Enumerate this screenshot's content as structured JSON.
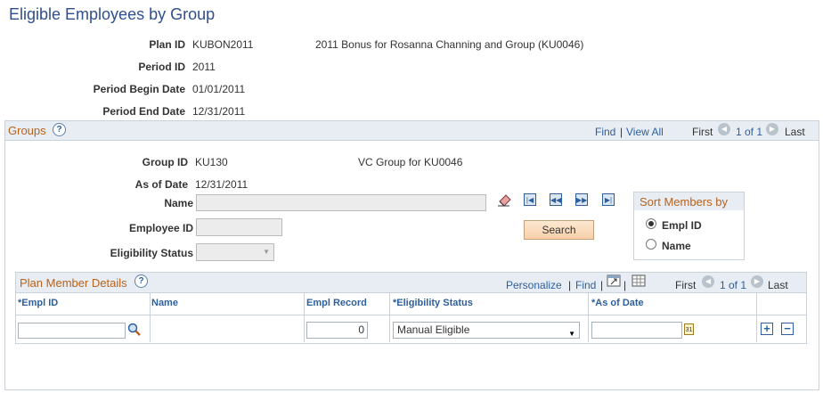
{
  "page": {
    "title": "Eligible Employees by Group"
  },
  "plan": {
    "plan_id_label": "Plan ID",
    "plan_id": "KUBON2011",
    "plan_desc": "2011 Bonus for Rosanna Channing and Group (KU0046)",
    "period_id_label": "Period ID",
    "period_id": "2011",
    "begin_label": "Period Begin Date",
    "begin": "01/01/2011",
    "end_label": "Period End Date",
    "end": "12/31/2011"
  },
  "groups": {
    "title": "Groups",
    "find": "Find",
    "view_all": "View All",
    "first": "First",
    "counter": "1 of 1",
    "last": "Last",
    "group_id_label": "Group ID",
    "group_id": "KU130",
    "group_desc": "VC Group for KU0046",
    "as_of_label": "As of Date",
    "as_of": "12/31/2011",
    "name_label": "Name",
    "name_value": "",
    "empl_id_label": "Employee ID",
    "empl_id_value": "",
    "elig_label": "Eligibility Status",
    "elig_value": "",
    "search_label": "Search",
    "sort": {
      "title": "Sort Members by",
      "opt1": "Empl ID",
      "opt2": "Name",
      "selected": "Empl ID"
    }
  },
  "details": {
    "title": "Plan Member Details",
    "personalize": "Personalize",
    "find": "Find",
    "first": "First",
    "counter": "1 of 1",
    "last": "Last",
    "columns": {
      "empl_id": "*Empl ID",
      "name": "Name",
      "empl_record": "Empl Record",
      "elig_status": "*Eligibility Status",
      "as_of_date": "*As of Date"
    },
    "row": {
      "empl_id": "",
      "name": "",
      "empl_record": "0",
      "elig_status": "Manual Eligible",
      "as_of_date": ""
    }
  },
  "icons": {
    "help": "?",
    "first_arrow": "◀",
    "next_arrow": "▶",
    "plus": "+",
    "minus": "−",
    "calendar": "31"
  }
}
